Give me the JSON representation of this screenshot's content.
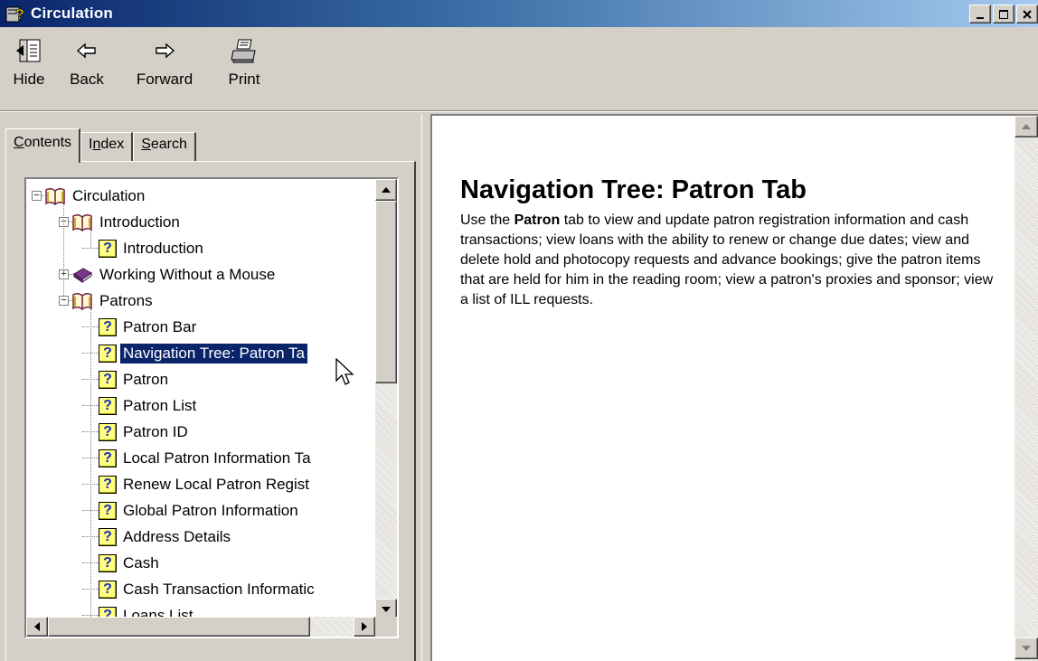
{
  "window": {
    "title": "Circulation"
  },
  "toolbar": {
    "buttons": [
      {
        "label": "Hide",
        "icon": "hide-pane-icon"
      },
      {
        "label": "Back",
        "icon": "back-arrow-icon"
      },
      {
        "label": "Forward",
        "icon": "forward-arrow-icon"
      },
      {
        "label": "Print",
        "icon": "printer-icon"
      }
    ]
  },
  "tabs": [
    {
      "label": "Contents",
      "access_key": "C",
      "active": true
    },
    {
      "label": "Index",
      "access_key": "n",
      "active": false
    },
    {
      "label": "Search",
      "access_key": "S",
      "active": false
    }
  ],
  "tree": [
    {
      "label": "Circulation",
      "type": "book-open",
      "expander": "minus"
    },
    {
      "label": "Introduction",
      "type": "book-open",
      "expander": "minus"
    },
    {
      "label": "Introduction",
      "type": "topic"
    },
    {
      "label": "Working Without a Mouse",
      "type": "book-closed",
      "expander": "plus"
    },
    {
      "label": "Patrons",
      "type": "book-open",
      "expander": "minus"
    },
    {
      "label": "Patron Bar",
      "type": "topic"
    },
    {
      "label": "Navigation Tree: Patron Ta",
      "type": "topic",
      "selected": true
    },
    {
      "label": "Patron",
      "type": "topic"
    },
    {
      "label": "Patron List",
      "type": "topic"
    },
    {
      "label": "Patron ID",
      "type": "topic"
    },
    {
      "label": "Local Patron Information Ta",
      "type": "topic"
    },
    {
      "label": "Renew Local Patron Regist",
      "type": "topic"
    },
    {
      "label": "Global Patron Information",
      "type": "topic"
    },
    {
      "label": "Address Details",
      "type": "topic"
    },
    {
      "label": "Cash",
      "type": "topic"
    },
    {
      "label": "Cash Transaction Informatic",
      "type": "topic"
    },
    {
      "label": "Loans List",
      "type": "topic"
    }
  ],
  "content": {
    "heading": "Navigation Tree: Patron Tab",
    "body_before": "Use the ",
    "body_bold": "Patron",
    "body_after": " tab to view and update patron registration information and cash transactions; view loans with the ability to renew or change due dates; view and delete hold and photocopy requests and advance bookings; give the patron items that are held for him in the reading room; view a patron's proxies and sponsor; view a list of ILL requests."
  },
  "colors": {
    "title_start": "#0a246a",
    "title_end": "#a6caf0",
    "selection": "#0a246a"
  }
}
